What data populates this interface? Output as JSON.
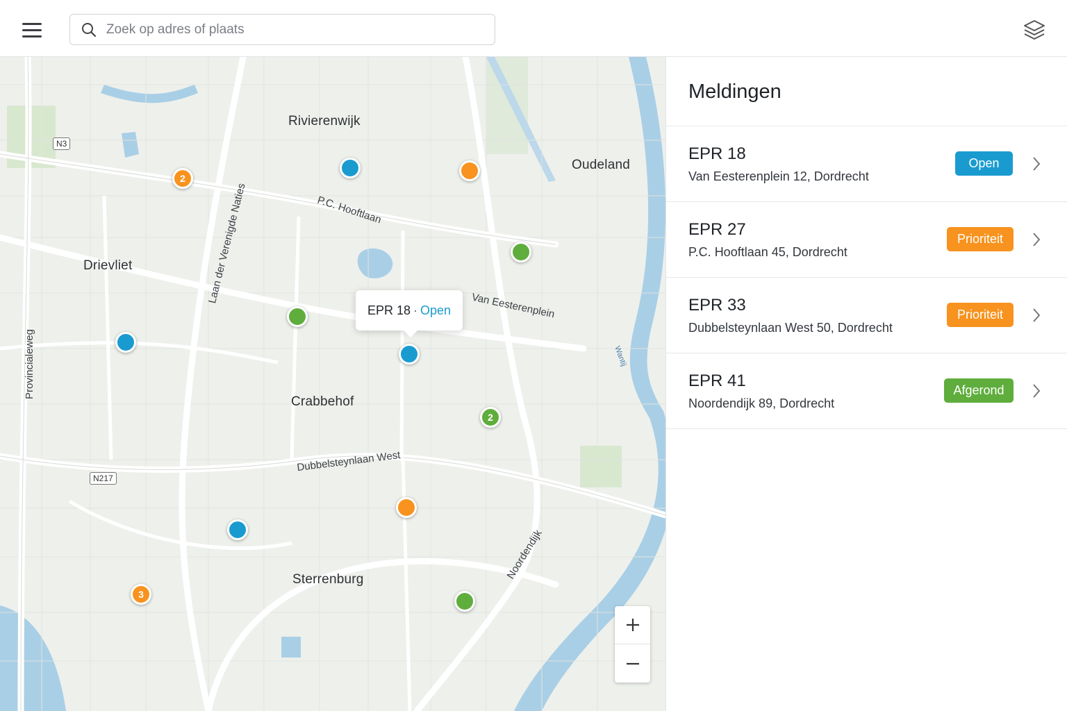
{
  "search": {
    "placeholder": "Zoek op adres of plaats"
  },
  "icons": {
    "menu": "menu-icon",
    "search": "search-icon",
    "layers": "layers-icon",
    "zoom_in": "plus-icon",
    "zoom_out": "minus-icon",
    "chevron": "chevron-right-icon"
  },
  "map": {
    "places": [
      "Rivierenwijk",
      "Oudeland",
      "Drievliet",
      "Crabbehof",
      "Sterrenburg"
    ],
    "streets": [
      "P.C. Hooftlaan",
      "Laan der Verenigde Naties",
      "Van Eesterenplein",
      "Provincialeweg",
      "Dubbelsteynlaan West",
      "Noordendijk"
    ],
    "road_shields": [
      "N3",
      "N217"
    ],
    "water": "Wantij",
    "cluster_counts": [
      "2",
      "2",
      "3"
    ],
    "popup": {
      "id": "EPR 18",
      "separator": "·",
      "status": "Open"
    }
  },
  "panel": {
    "title": "Meldingen",
    "items": [
      {
        "id": "EPR 18",
        "address": "Van Eesterenplein 12, Dordrecht",
        "status": "Open",
        "color": "#1a9bd0"
      },
      {
        "id": "EPR 27",
        "address": "P.C. Hooftlaan 45, Dordrecht",
        "status": "Prioriteit",
        "color": "#f7931e"
      },
      {
        "id": "EPR 33",
        "address": "Dubbelsteynlaan West 50, Dordrecht",
        "status": "Prioriteit",
        "color": "#f7931e"
      },
      {
        "id": "EPR 41",
        "address": "Noordendijk 89, Dordrecht",
        "status": "Afgerond",
        "color": "#5fad3c"
      }
    ]
  },
  "colors": {
    "open": "#1a9bd0",
    "priority": "#f7931e",
    "done": "#5fad3c",
    "water": "#a9cfe6",
    "park": "#d5e6cc"
  }
}
